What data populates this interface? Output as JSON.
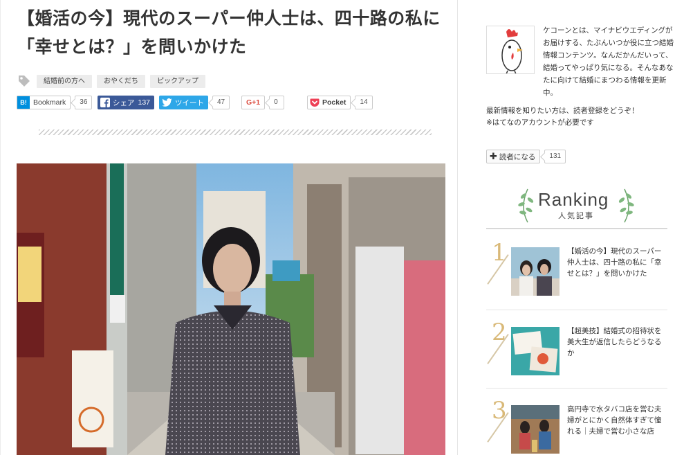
{
  "article": {
    "title": "【婚活の今】現代のスーパー仲人士は、四十路の私に「幸せとは？」を問いかけた",
    "tags": [
      "結婚前の方へ",
      "おやくだち",
      "ピックアップ"
    ]
  },
  "share": {
    "hatena": {
      "label": "Bookmark",
      "logo": "B!",
      "count": "36"
    },
    "facebook": {
      "label": "シェア",
      "count_inline": "137"
    },
    "twitter": {
      "label": "ツイート",
      "count": "47"
    },
    "googleplus": {
      "label": "G+1",
      "count": "0"
    },
    "pocket": {
      "label": "Pocket",
      "count": "14"
    }
  },
  "sidebar": {
    "about": "ケコーンとは、マイナビウエディングがお届けする、たぶんいつか役に立つ結婚情報コンテンツ。なんだかんだいって、結婚ってやっぱり気になる。そんなあなたに向けて結婚にまつわる情報を更新中。",
    "notice_line1": "最新情報を知りたい方は、読者登録をどうぞ！",
    "notice_line2": "※はてなのアカウントが必要です",
    "subscribe_label": "読者になる",
    "subscribe_count": "131",
    "ranking_title": "Ranking",
    "ranking_subtitle": "人気記事",
    "ranking": [
      {
        "num": "1",
        "title": "【婚活の今】現代のスーパー仲人士は、四十路の私に「幸せとは？」を問いかけた"
      },
      {
        "num": "2",
        "title": "【超美技】結婚式の招待状を美大生が返信したらどうなるか"
      },
      {
        "num": "3",
        "title": "高円寺で水タバコ店を営む夫婦がとにかく自然体すぎて憧れる｜夫婦で営む小さな店"
      }
    ]
  },
  "colors": {
    "facebook": "#3b5998",
    "twitter": "#2ea7e8",
    "hatena": "#008fde",
    "pocket": "#ee4056",
    "rank_gold": "#d9b978"
  }
}
